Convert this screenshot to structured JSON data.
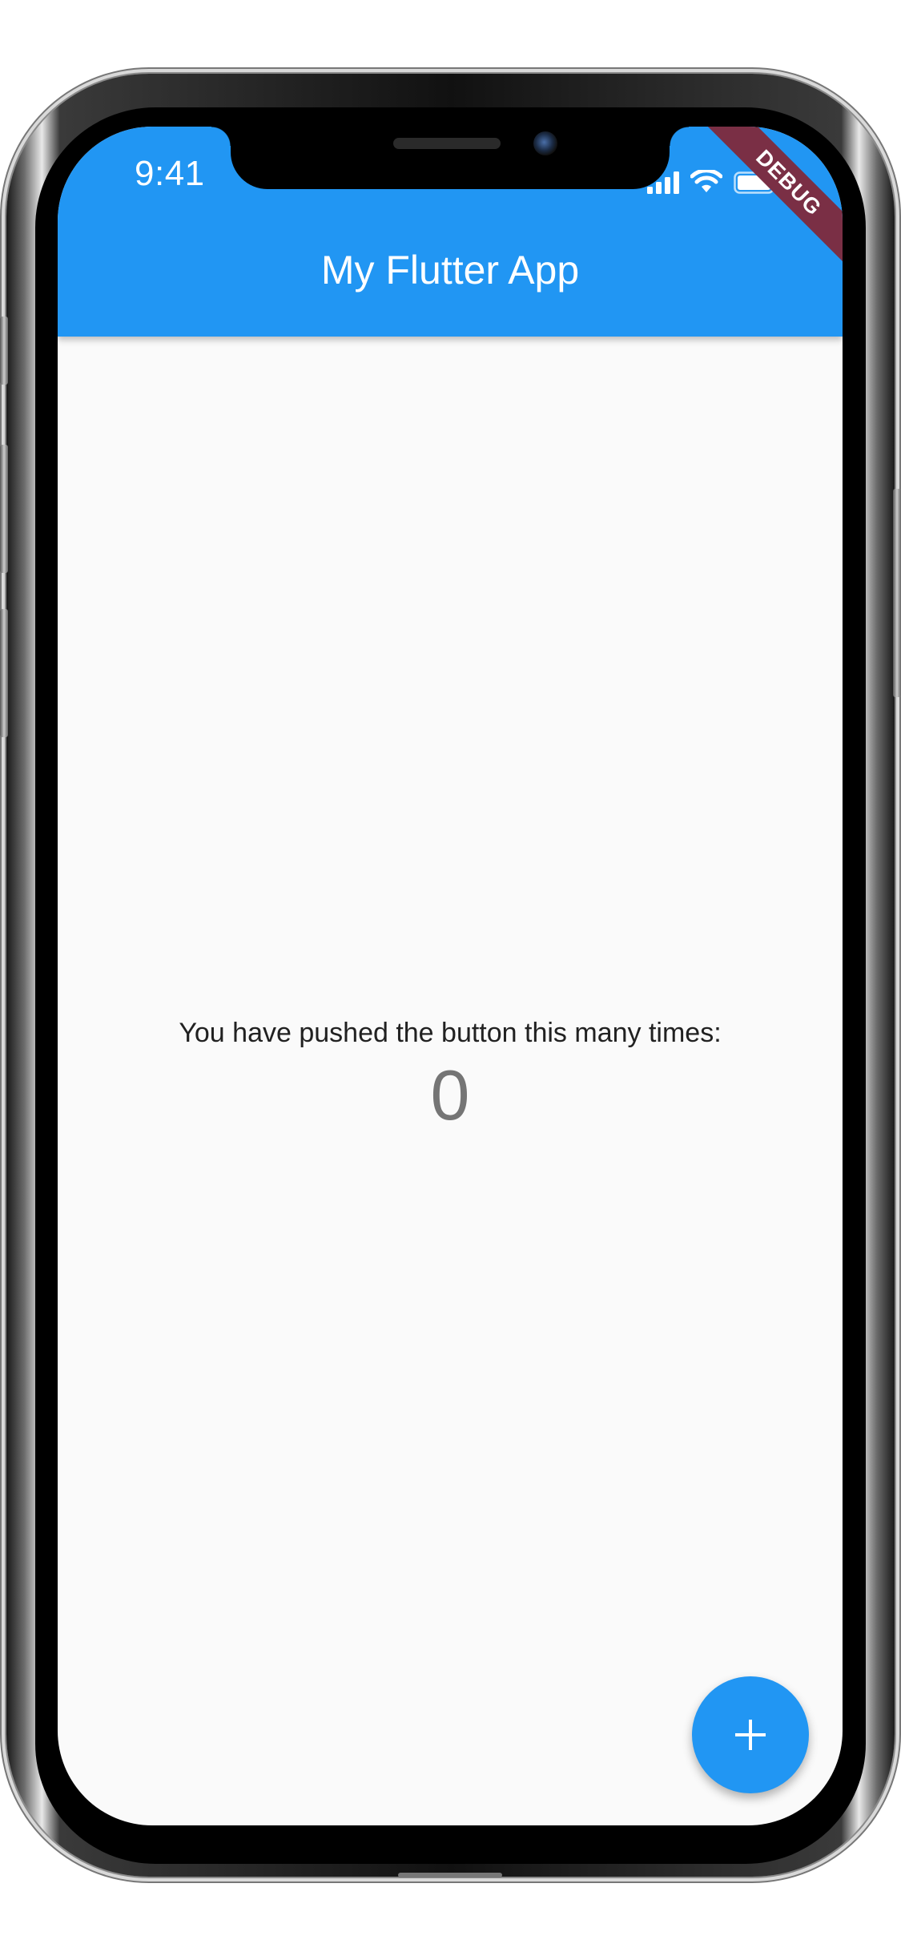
{
  "colors": {
    "accent": "#2196f3",
    "debug_ribbon": "#7a2f45",
    "background": "#fafafa"
  },
  "status_bar": {
    "time": "9:41",
    "icons": [
      "signal-icon",
      "wifi-icon",
      "battery-icon"
    ]
  },
  "app_bar": {
    "title": "My Flutter App"
  },
  "debug_banner": {
    "label": "DEBUG"
  },
  "body": {
    "message": "You have pushed the button this many times:",
    "counter": "0"
  },
  "fab": {
    "icon": "plus-icon"
  }
}
